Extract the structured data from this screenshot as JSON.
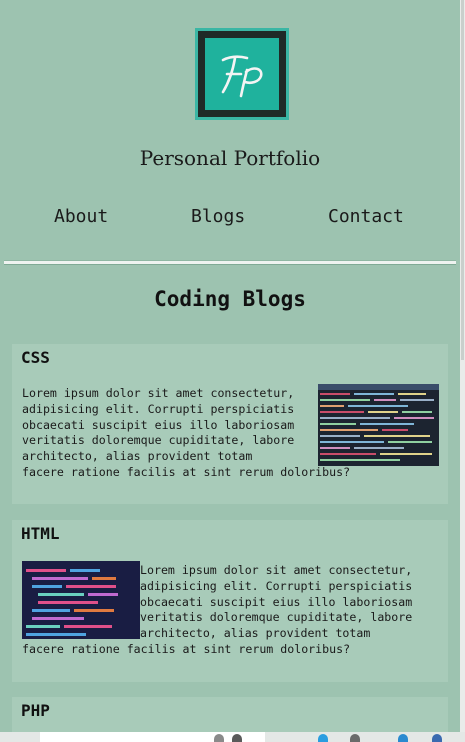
{
  "header": {
    "logo_text": "FP",
    "title": "Personal Portfolio"
  },
  "nav": {
    "items": [
      {
        "label": "About"
      },
      {
        "label": "Blogs"
      },
      {
        "label": "Contact"
      }
    ]
  },
  "main": {
    "section_title": "Coding Blogs",
    "posts": [
      {
        "title": "CSS",
        "body_lines": [
          "Lorem ipsum dolor sit amet consectetur,",
          "adipisicing elit. Corrupti perspiciatis",
          "obcaecati suscipit eius illo laboriosam",
          "veritatis doloremque cupiditate, labore",
          "architecto, alias provident totam",
          "facere ratione facilis at sint rerum doloribus?"
        ],
        "image_icon": "code-screenshot"
      },
      {
        "title": "HTML",
        "body_lines": [
          "Lorem ipsum dolor sit amet consectetur,",
          "adipisicing elit. Corrupti perspiciatis",
          "obcaecati suscipit eius illo laboriosam",
          "veritatis doloremque cupiditate, labore",
          "architecto, alias provident totam",
          "facere ratione facilis at sint rerum doloribus?"
        ],
        "image_icon": "code-screenshot"
      },
      {
        "title": "PHP"
      }
    ]
  },
  "colors": {
    "background": "#9dc3b0",
    "card": "#a8cbb9",
    "logo_teal": "#1fb29d",
    "logo_dark": "#1f2a27"
  }
}
